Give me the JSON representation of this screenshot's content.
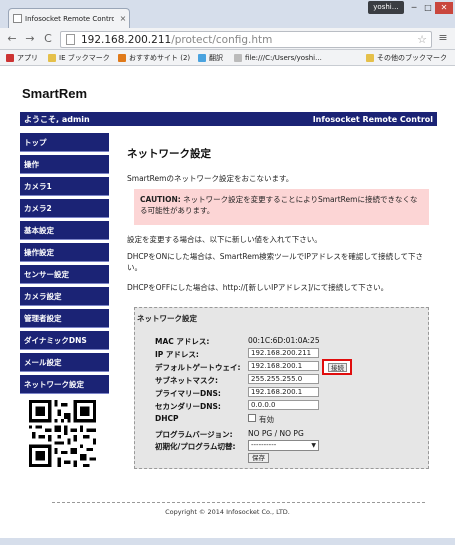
{
  "browser": {
    "tab_title": "Infosocket Remote Control",
    "tab_close": "×",
    "user_badge": "yoshi…",
    "win_min": "─",
    "win_max": "□",
    "win_close": "✕",
    "back": "←",
    "forward": "→",
    "reload": "C",
    "url_host": "192.168.200.211",
    "url_path": "/protect/config.htm",
    "star": "☆",
    "menu": "≡",
    "bookmarks": [
      "アプリ",
      "IE ブックマーク",
      "おすすめサイト (2)",
      "翻訳",
      "file:///C:/Users/yoshi...",
      "その他のブックマーク"
    ],
    "bookmark_colors": [
      "#c33",
      "#3a6fc4",
      "#e07a1a",
      "#4aa3df",
      "#999",
      "#e5c04a"
    ]
  },
  "header": {
    "brand": "SmartRem",
    "welcome": "ようこそ, admin",
    "product": "Infosocket Remote Control"
  },
  "sidebar": {
    "items": [
      "トップ",
      "操作",
      "カメラ1",
      "カメラ2",
      "基本設定",
      "操作設定",
      "センサー設定",
      "カメラ設定",
      "管理者設定",
      "ダイナミックDNS",
      "メール設定",
      "ネットワーク設定"
    ]
  },
  "main": {
    "title": "ネットワーク設定",
    "intro": "SmartRemのネットワーク設定をおこないます。",
    "caution_label": "CAUTION:",
    "caution_text": "ネットワーク設定を変更することによりSmartRemに接続できなくなる可能性があります。",
    "para1": "設定を変更する場合は、以下に新しい値を入れて下さい。",
    "para2": "DHCPをONにした場合は、SmartRem検索ツールでIPアドレスを確認して接続して下さい。",
    "para3": "DHCPをOFFにした場合は、http://[新しいIPアドレス]/にて接続して下さい。"
  },
  "form": {
    "box_title": "ネットワーク設定",
    "mac_label": "MAC アドレス:",
    "mac_value": "00:1C:6D:01:0A:25",
    "ip_label": "IP アドレス:",
    "ip_value": "192.168.200.211",
    "gw_label": "デフォルトゲートウェイ:",
    "gw_value": "192.168.200.1",
    "ping_button": "接続",
    "mask_label": "サブネットマスク:",
    "mask_value": "255.255.255.0",
    "dns1_label": "プライマリーDNS:",
    "dns1_value": "192.168.200.1",
    "dns2_label": "セカンダリーDNS:",
    "dns2_value": "0.0.0.0",
    "dhcp_label": "DHCP",
    "dhcp_option": "有効",
    "version_label": "プログラムバージョン:",
    "version_value": "NO PG / NO PG",
    "init_label": "初期化/プログラム切替:",
    "init_select": "----------",
    "save_button": "保存"
  },
  "footer": {
    "copyright": "Copyright © 2014 Infosocket Co., LTD."
  }
}
